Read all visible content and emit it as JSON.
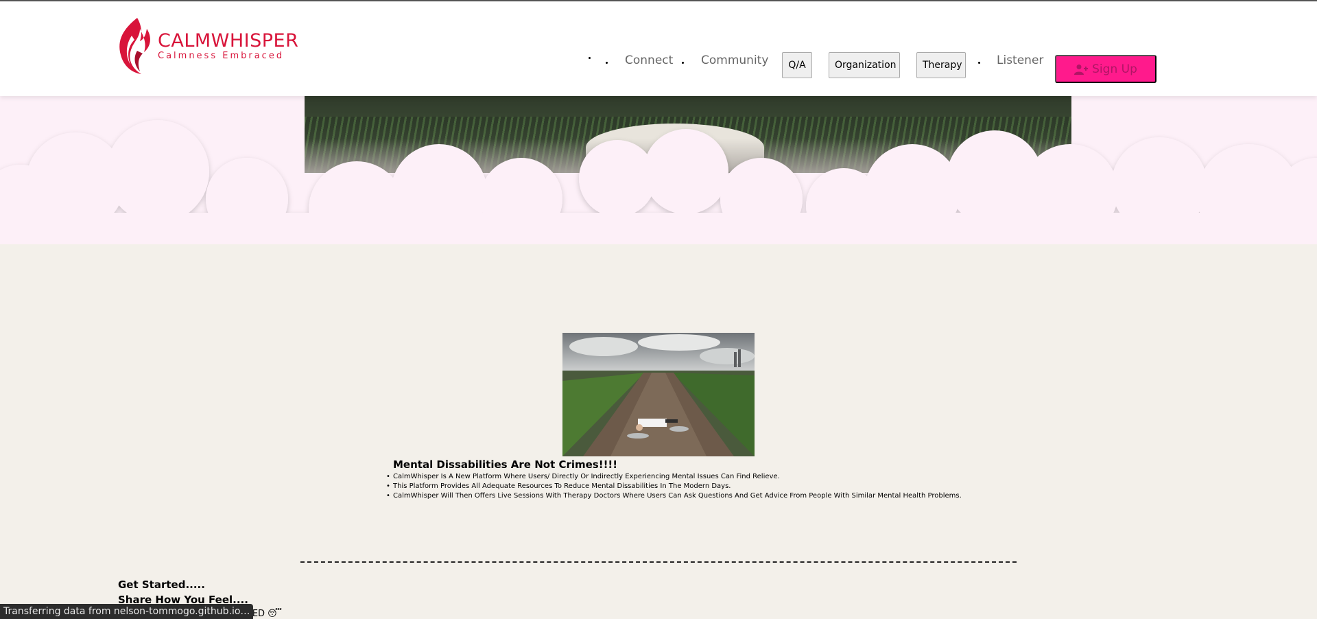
{
  "brand": {
    "title": "CALMWHISPER",
    "tagline": "Calmness Embraced",
    "color": "#d8143a"
  },
  "nav": {
    "links": {
      "connect": "Connect",
      "community": "Community",
      "listener": "Listener"
    },
    "buttons": {
      "qa": "Q/A",
      "organization": "Organization",
      "therapy": "Therapy"
    },
    "signup": {
      "label": "Sign Up",
      "icon": "user-plus-icon",
      "background": "#ff1a8c"
    }
  },
  "content": {
    "title": "Mental Dissabilities Are Not Crimes!!!!",
    "bullets": [
      "CalmWhisper Is A New Platform Where Users/ Directly Or Indirectly Experiencing Mental Issues Can Find Relieve.",
      "This Platform Provides All Adequate Resources To Reduce Mental Dissabilities In The Modern Days.",
      "CalmWhisper Will Then Offers Live Sessions With Therapy Doctors Where Users Can Ask Questions And Get Advice From People With Similar Mental Health Problems."
    ]
  },
  "get_started": {
    "heading": "Get Started.....",
    "share": "Share How You Feel....",
    "moods_visible": "WORRIED 😥 STRESSED 😓 TIRED 😴"
  },
  "status_bar": {
    "text": "Transferring data from nelson-tommogo.github.io…"
  },
  "colors": {
    "page_bg": "#f3f0ea",
    "hero_bg": "#fdf0f8",
    "header_bg": "#ffffff"
  }
}
